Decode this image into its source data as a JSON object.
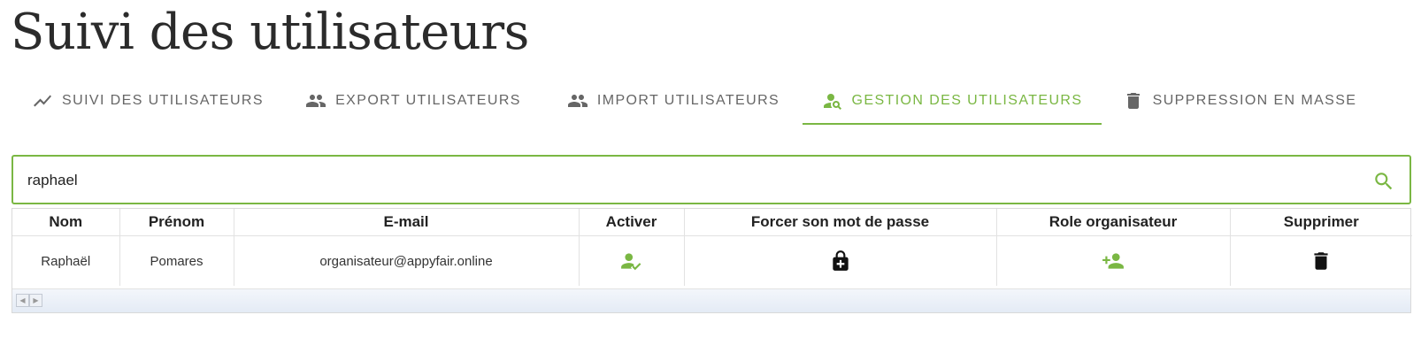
{
  "page": {
    "title": "Suivi des utilisateurs"
  },
  "tabs": [
    {
      "label": "SUIVI DES UTILISATEURS",
      "icon": "trending-icon",
      "active": false
    },
    {
      "label": "EXPORT UTILISATEURS",
      "icon": "group-icon",
      "active": false
    },
    {
      "label": "IMPORT UTILISATEURS",
      "icon": "group-icon",
      "active": false
    },
    {
      "label": "GESTION DES UTILISATEURS",
      "icon": "person-search-icon",
      "active": true
    },
    {
      "label": "SUPPRESSION EN MASSE",
      "icon": "trash-icon",
      "active": false
    }
  ],
  "search": {
    "value": "raphael",
    "icon": "search-icon"
  },
  "table": {
    "columns": [
      "Nom",
      "Prénom",
      "E-mail",
      "Activer",
      "Forcer son mot de passe",
      "Role organisateur",
      "Supprimer"
    ],
    "rows": [
      {
        "nom": "Raphaël",
        "prenom": "Pomares",
        "email": "organisateur@appyfair.online",
        "activer_icon": "person-check-icon",
        "forcer_icon": "lock-plus-icon",
        "role_icon": "person-add-icon",
        "supprimer_icon": "trash-icon"
      }
    ]
  },
  "colors": {
    "accent": "#7ab743",
    "tab_text": "#666666",
    "icon_dark": "#111111"
  }
}
